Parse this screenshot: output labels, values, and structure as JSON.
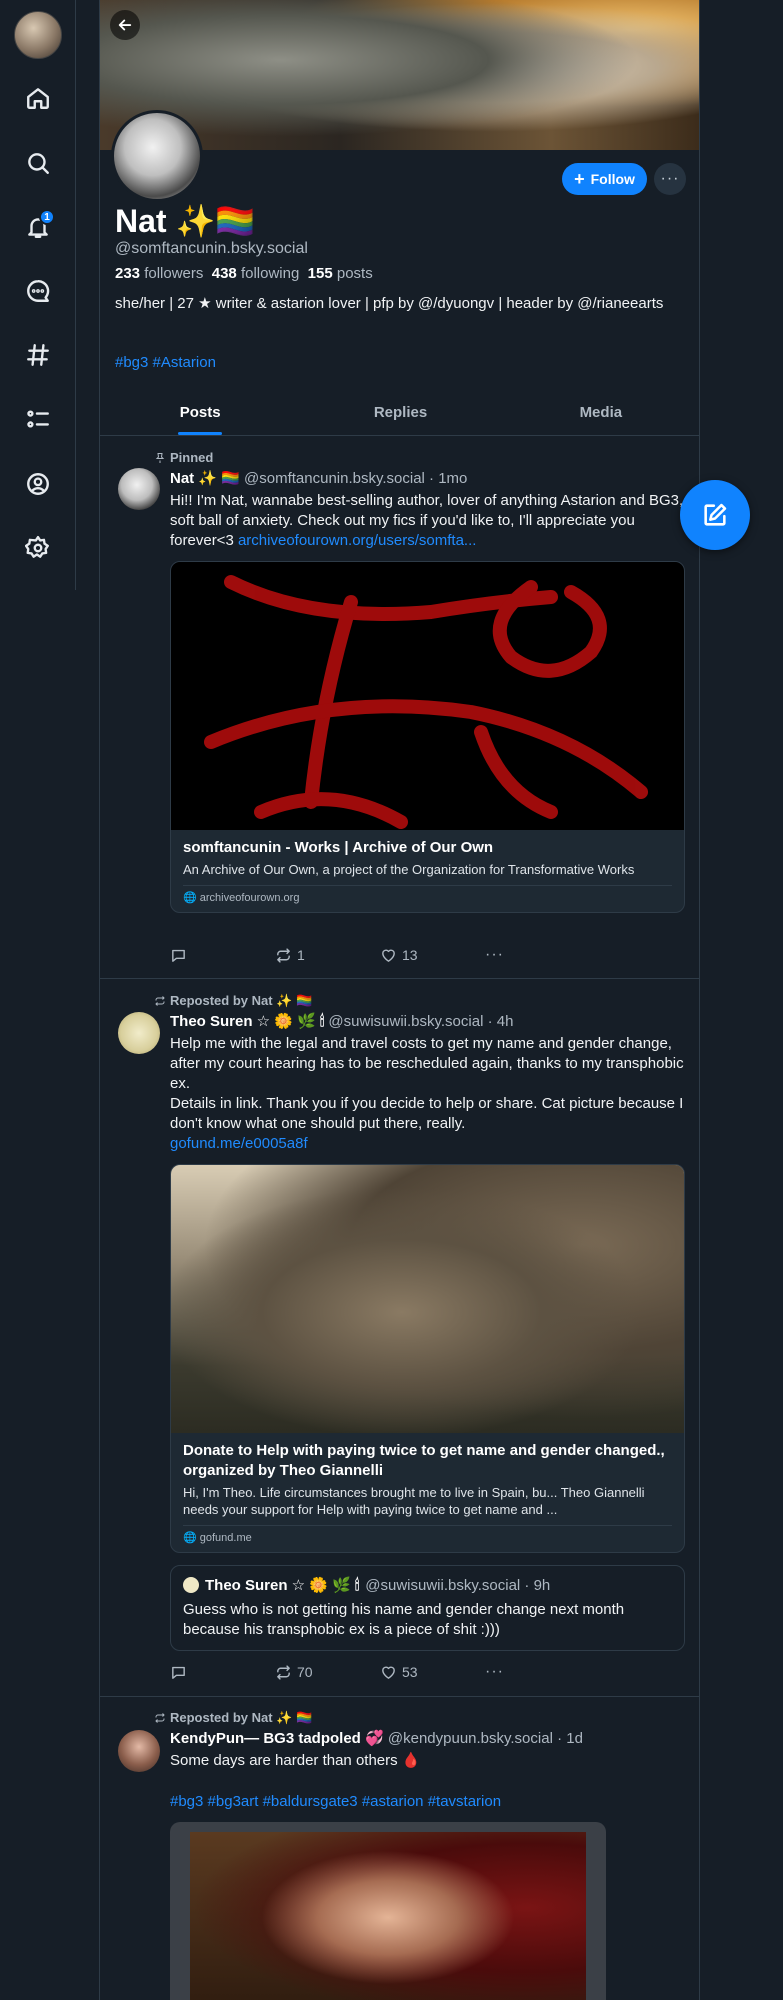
{
  "nav": {
    "notification_count": "1"
  },
  "profile": {
    "display_name": "Nat ✨🏳️‍🌈",
    "handle": "@somftancunin.bsky.social",
    "follow_label": "Follow",
    "more_label": "···",
    "followers_count": "233",
    "followers_label": "followers",
    "following_count": "438",
    "following_label": "following",
    "posts_count": "155",
    "posts_label": "posts",
    "bio": "she/her | 27 ★ writer & astarion lover | pfp by @/dyuongv | header by @/rianeearts",
    "tags": "#bg3 #Astarion"
  },
  "tabs": [
    "Posts",
    "Replies",
    "Media"
  ],
  "posts": [
    {
      "context": "Pinned",
      "author": "Nat ✨ 🏳️‍🌈",
      "handle_time": "@somftancunin.bsky.social · 1mo",
      "text": "Hi!! I'm Nat, wannabe best-selling author, lover of anything Astarion and BG3, soft ball of anxiety. Check out my fics if you'd like to, I'll appreciate you forever<3 ",
      "link": "archiveofourown.org/users/somfta...",
      "card": {
        "title": "somftancunin - Works       |       Archive of Our Own",
        "description": "An Archive of Our Own, a project of the     Organization for Transformative Works",
        "domain": "archiveofourown.org"
      },
      "replies": "",
      "reposts": "1",
      "likes": "13"
    },
    {
      "context": "Reposted by Nat ✨ 🏳️‍🌈",
      "author": "Theo Suren ☆ 🌼 🌿 🕯",
      "handle_time": "@suwisuwii.bsky.social · 4h",
      "text": "Help me with the legal and travel costs to get my name and gender change, after my court hearing has to be rescheduled again, thanks to my transphobic ex.\nDetails in link. Thank you if you decide to help or share. Cat picture because I don't know what one should put there, really.",
      "link": "gofund.me/e0005a8f",
      "card": {
        "title": "Donate to Help with paying twice to get name and gender changed., organized by Theo Giannelli",
        "description": "Hi, I'm Theo. Life circumstances brought me to live in Spain, bu... Theo Giannelli needs your support for Help with paying twice to get name and ...",
        "domain": "gofund.me"
      },
      "quote": {
        "author": "Theo Suren ☆ 🌼 🌿 🕯",
        "handle_time": "@suwisuwii.bsky.social · 9h",
        "text": "Guess who is not getting his name and gender change next month because his transphobic ex is a piece of shit :)))"
      },
      "replies": "",
      "reposts": "70",
      "likes": "53"
    },
    {
      "context": "Reposted by Nat ✨ 🏳️‍🌈",
      "author": "KendyPun— BG3 tadpoled 💞",
      "handle_time": "@kendypuun.bsky.social · 1d",
      "text": "Some days are harder than others 🩸",
      "tags": "#bg3 #bg3art #baldursgate3 #astarion #tavstarion"
    }
  ]
}
